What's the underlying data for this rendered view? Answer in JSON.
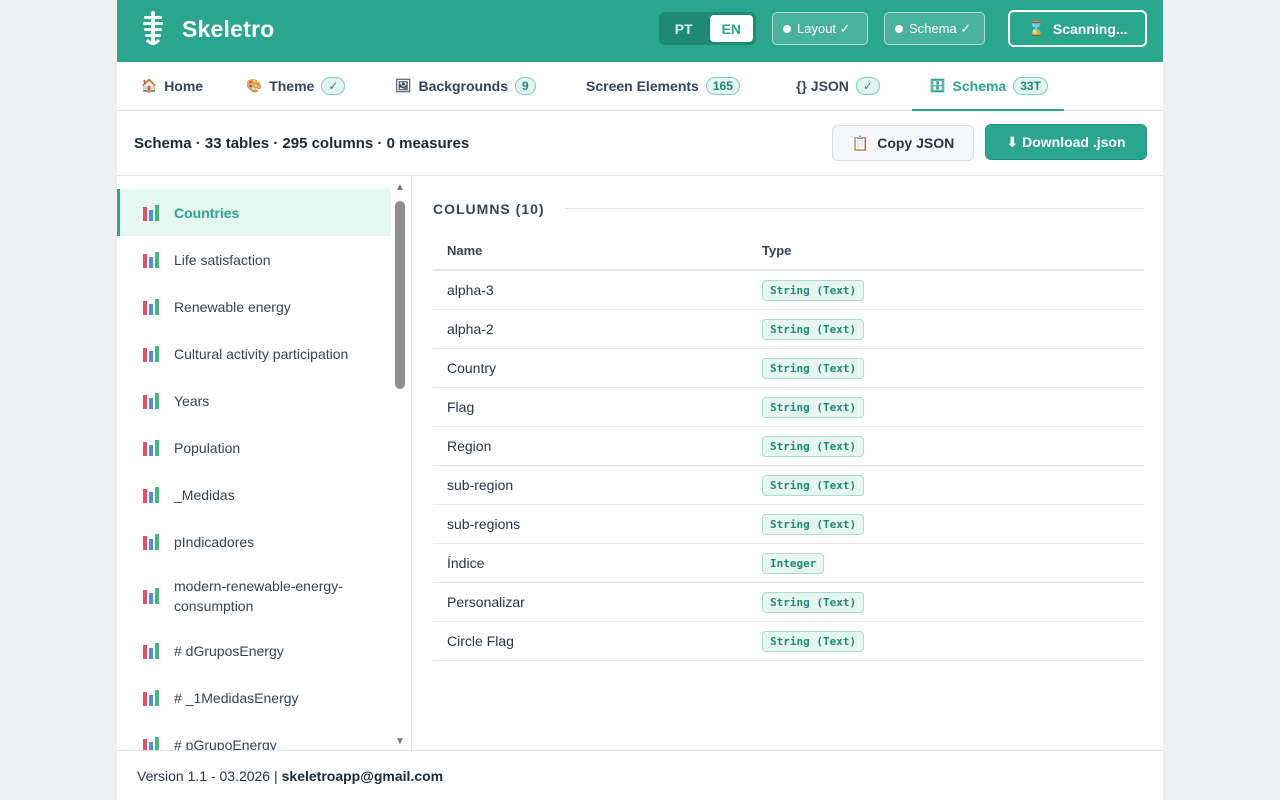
{
  "header": {
    "brand": "Skeletro",
    "lang_options": [
      "PT",
      "EN"
    ],
    "lang_active": "EN",
    "layout_pill": "Layout ✓",
    "schema_pill": "Schema ✓",
    "scan_label": "Scanning..."
  },
  "tabs": [
    {
      "label": "Home",
      "icon": "house-icon"
    },
    {
      "label": "Theme",
      "badge": "✓",
      "icon": "palette-icon"
    },
    {
      "label": "Backgrounds",
      "badge": "9",
      "icon": "picture-icon"
    },
    {
      "label": "Screen Elements",
      "badge": "165"
    },
    {
      "label": "{} JSON",
      "badge": "✓"
    },
    {
      "label": "Schema",
      "badge": "33T",
      "icon": "cylinder-icon",
      "active": true
    }
  ],
  "toolbar": {
    "summary": "Schema · 33 tables · 295 columns · 0 measures",
    "copy_label": "Copy JSON",
    "download_label": "⬇ Download .json"
  },
  "sidebar": {
    "items": [
      "Countries",
      "Life satisfaction",
      "Renewable energy",
      "Cultural activity participation",
      "Years",
      "Population",
      "_Medidas",
      "pIndicadores",
      "modern-renewable-energy-consumption",
      "# dGruposEnergy",
      "# _1MedidasEnergy",
      "# pGrupoEnergy"
    ],
    "active_index": 0
  },
  "main": {
    "section_title": "COLUMNS (10)",
    "col_headers": [
      "Name",
      "Type"
    ],
    "rows": [
      {
        "name": "alpha-3",
        "type": "String (Text)"
      },
      {
        "name": "alpha-2",
        "type": "String (Text)"
      },
      {
        "name": "Country",
        "type": "String (Text)"
      },
      {
        "name": "Flag",
        "type": "String (Text)"
      },
      {
        "name": "Region",
        "type": "String (Text)"
      },
      {
        "name": "sub-region",
        "type": "String (Text)"
      },
      {
        "name": "sub-regions",
        "type": "String (Text)"
      },
      {
        "name": "Índice",
        "type": "Integer"
      },
      {
        "name": "Personalizar",
        "type": "String (Text)"
      },
      {
        "name": "Circle Flag",
        "type": "String (Text)"
      }
    ]
  },
  "footer": {
    "version": "Version 1.1 - 03.2026 |",
    "email": "skeletroapp@gmail.com"
  },
  "colors": {
    "accent": "#2aa68c",
    "accent_dark": "#1f8a73"
  }
}
